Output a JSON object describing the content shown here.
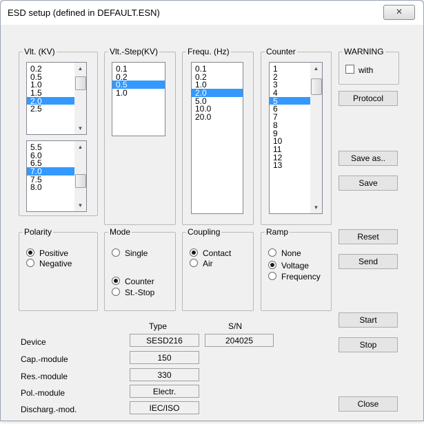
{
  "window": {
    "title": "ESD setup (defined in DEFAULT.ESN)",
    "close_icon": "close-icon"
  },
  "voltage": {
    "label": "Vlt. (KV)",
    "list1": {
      "items": [
        "0.2",
        "0.5",
        "1.0",
        "1.5",
        "2.0",
        "2.5"
      ],
      "selected": "2.0"
    },
    "list2": {
      "items": [
        "5.5",
        "6.0",
        "6.5",
        "7.0",
        "7.5",
        "8.0"
      ],
      "selected": "7.0"
    }
  },
  "vstep": {
    "label": "Vlt.-Step(KV)",
    "items": [
      "0.1",
      "0.2",
      "0.5",
      "1.0"
    ],
    "selected": "0.5"
  },
  "frequency": {
    "label": "Frequ. (Hz)",
    "items": [
      "0.1",
      "0.2",
      "1.0",
      "2.0",
      "5.0",
      "10.0",
      "20.0"
    ],
    "selected": "2.0"
  },
  "counter": {
    "label": "Counter",
    "items": [
      "1",
      "2",
      "3",
      "4",
      "5",
      "6",
      "7",
      "8",
      "9",
      "10",
      "11",
      "12",
      "13"
    ],
    "selected": "5"
  },
  "warning": {
    "label": "WARNING",
    "checkbox_label": "with",
    "checked": false
  },
  "polarity": {
    "label": "Polarity",
    "options": [
      "Positive",
      "Negative"
    ],
    "selected": "Positive"
  },
  "mode": {
    "label": "Mode",
    "options": [
      "Single",
      "Counter",
      "St.-Stop"
    ],
    "selected": "Counter"
  },
  "coupling": {
    "label": "Coupling",
    "options": [
      "Contact",
      "Air"
    ],
    "selected": "Contact"
  },
  "ramp": {
    "label": "Ramp",
    "options": [
      "None",
      "Voltage",
      "Frequency"
    ],
    "selected": "Voltage"
  },
  "buttons": {
    "protocol": "Protocol",
    "save_as": "Save as..",
    "save": "Save",
    "reset": "Reset",
    "send": "Send",
    "start": "Start",
    "stop": "Stop",
    "close": "Close"
  },
  "info": {
    "type_header": "Type",
    "sn_header": "S/N",
    "rows": [
      {
        "label": "Device",
        "type": "SESD216",
        "sn": "204025"
      },
      {
        "label": "Cap.-module",
        "type": "150"
      },
      {
        "label": "Res.-module",
        "type": "330"
      },
      {
        "label": "Pol.-module",
        "type": "Electr."
      },
      {
        "label": "Discharg.-mod.",
        "type": "IEC/ISO"
      }
    ]
  }
}
